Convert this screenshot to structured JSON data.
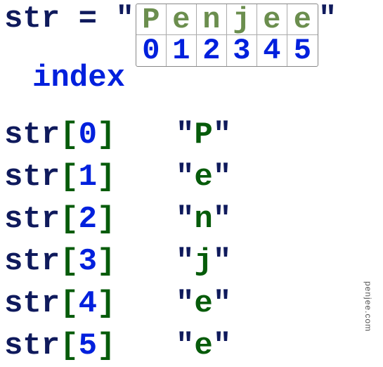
{
  "assignment": {
    "var": "str",
    "equals": "=",
    "quote": "\"",
    "chars": [
      "P",
      "e",
      "n",
      "j",
      "e",
      "e"
    ],
    "indices": [
      "0",
      "1",
      "2",
      "3",
      "4",
      "5"
    ]
  },
  "index_label": "index",
  "lookups": [
    {
      "var": "str",
      "idx": "0",
      "val": "P"
    },
    {
      "var": "str",
      "idx": "1",
      "val": "e"
    },
    {
      "var": "str",
      "idx": "2",
      "val": "n"
    },
    {
      "var": "str",
      "idx": "3",
      "val": "j"
    },
    {
      "var": "str",
      "idx": "4",
      "val": "e"
    },
    {
      "var": "str",
      "idx": "5",
      "val": "e"
    }
  ],
  "brackets": {
    "open": "[",
    "close": "]"
  },
  "watermark": "penjee.com"
}
